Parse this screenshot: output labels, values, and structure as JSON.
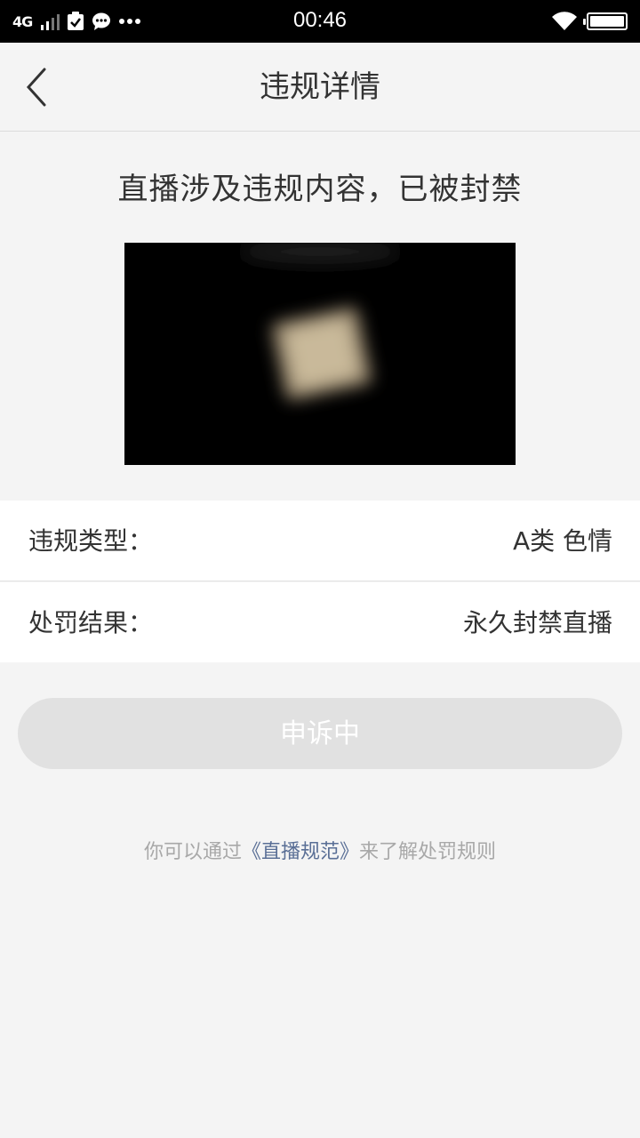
{
  "status_bar": {
    "network": "4G",
    "time": "00:46",
    "icons": [
      "signal-icon",
      "clipboard-check-icon",
      "chat-icon",
      "more-dots-icon",
      "wifi-icon",
      "battery-icon"
    ]
  },
  "header": {
    "title": "违规详情",
    "back_icon": "chevron-left-icon"
  },
  "headline": "直播涉及违规内容，已被封禁",
  "details": [
    {
      "label": "违规类型：",
      "value": "A类 色情"
    },
    {
      "label": "处罚结果：",
      "value": "永久封禁直播"
    }
  ],
  "appeal_button": "申诉中",
  "footnote": {
    "prefix": "你可以通过",
    "link": "《直播规范》",
    "suffix": "来了解处罚规则"
  },
  "colors": {
    "background": "#f4f4f4",
    "text": "#333333",
    "muted": "#a8a8a8",
    "link": "#5a6f96",
    "button_disabled": "#e1e1e1"
  }
}
